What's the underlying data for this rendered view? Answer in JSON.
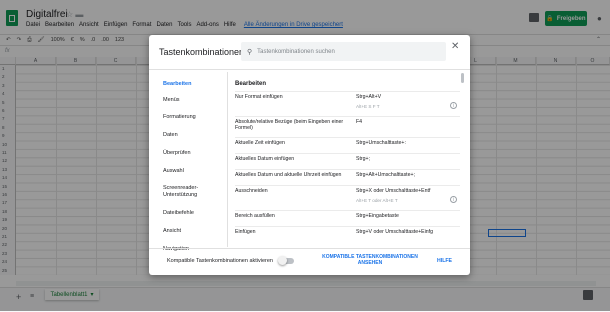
{
  "header": {
    "title": "Digitalfrei",
    "menu": [
      "Datei",
      "Bearbeiten",
      "Ansicht",
      "Einfügen",
      "Format",
      "Daten",
      "Tools",
      "Add-ons",
      "Hilfe"
    ],
    "save_status": "Alle Änderungen in Drive gespeichert",
    "share_label": "Freigeben"
  },
  "toolbar": {
    "zoom": "100%",
    "currency": "€",
    "percent": "%",
    "dec_less": ".0",
    "dec_more": ".00",
    "format": "123"
  },
  "formula_bar": {
    "fx": "fx"
  },
  "columns": [
    "A",
    "B",
    "C",
    "D",
    "E",
    "F",
    "G",
    "H",
    "I",
    "J",
    "K",
    "L",
    "M",
    "N",
    "O"
  ],
  "rows": [
    "1",
    "2",
    "3",
    "4",
    "5",
    "6",
    "7",
    "8",
    "9",
    "10",
    "11",
    "12",
    "13",
    "14",
    "15",
    "16",
    "17",
    "18",
    "19",
    "20",
    "21",
    "22",
    "23",
    "24",
    "25"
  ],
  "sheet": {
    "tab_label": "Tabellenblatt1"
  },
  "dialog": {
    "title": "Tastenkombinationen",
    "search_placeholder": "Tastenkombinationen suchen",
    "categories": [
      "Bearbeiten",
      "Menüs",
      "Formatierung",
      "Daten",
      "Überprüfen",
      "Auswahl",
      "Screenreader-Unterstützung",
      "Dateibefehle",
      "Ansicht",
      "Navigation"
    ],
    "active_category": "Bearbeiten",
    "section_title": "Bearbeiten",
    "shortcuts": [
      {
        "desc": "Nur Format einfügen",
        "keys": "Strg+Alt+V",
        "alt": "Alt+E  S  F  T"
      },
      {
        "desc": "Absolute/relative Bezüge (beim Eingeben einer Formel)",
        "keys": "F4",
        "alt": ""
      },
      {
        "desc": "Aktuelle Zeit einfügen",
        "keys": "Strg+Umschalttaste+:",
        "alt": ""
      },
      {
        "desc": "Aktuelles Datum einfügen",
        "keys": "Strg+;",
        "alt": ""
      },
      {
        "desc": "Aktuelles Datum und aktuelle Uhrzeit einfügen",
        "keys": "Strg+Alt+Umschalttaste+;",
        "alt": ""
      },
      {
        "desc": "Ausschneiden",
        "keys": "Strg+X oder Umschalttaste+Entf",
        "alt": "Alt+E  T  oder  Alt+E  T"
      },
      {
        "desc": "Bereich ausfüllen",
        "keys": "Strg+Eingabetaste",
        "alt": ""
      },
      {
        "desc": "Einfügen",
        "keys": "Strg+V oder Umschalttaste+Einfg",
        "alt": ""
      }
    ],
    "compat_label": "Kompatible Tastenkombinationen aktivieren",
    "compat_link": "KOMPATIBLE TASTENKOMBINATIONEN ANSEHEN",
    "help_link": "HILFE"
  },
  "colors": {
    "accent": "#1a73e8",
    "brand": "#0f9d58"
  }
}
